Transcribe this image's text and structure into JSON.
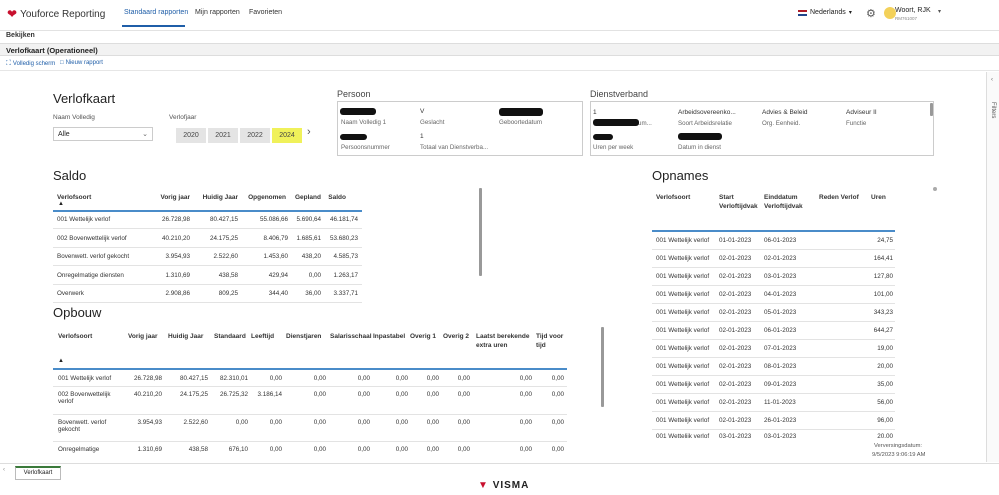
{
  "app": {
    "logo_text": "Youforce Reporting"
  },
  "nav": {
    "tabs": [
      "Standaard rapporten",
      "Mijn rapporten",
      "Favorieten"
    ],
    "active": "Standaard rapporten"
  },
  "header": {
    "language": "Nederlands",
    "user_name": "Woort, RJK",
    "user_id": "RM761007"
  },
  "subnav": {
    "label": "Bekijken"
  },
  "report": {
    "title": "Verlofkaart (Operationeel)"
  },
  "toolbar": {
    "fullscreen": "Volledig scherm",
    "new_report": "Nieuw rapport"
  },
  "filters": {
    "title": "Verlofkaart",
    "name_label": "Naam Volledig",
    "name_value": "Alle",
    "year_label": "Verlofjaar",
    "years": [
      "2020",
      "2021",
      "2022",
      "2024"
    ],
    "selected_year": "2024"
  },
  "persoon": {
    "title": "Persoon",
    "fields": [
      {
        "value": "",
        "label": "Naam Volledig 1"
      },
      {
        "value": "V",
        "label": "Geslacht"
      },
      {
        "value": "",
        "label": "Geboortedatum"
      },
      {
        "value": "",
        "label": "Persoonsnummer"
      },
      {
        "value": "1",
        "label": "Totaal van Dienstverba..."
      }
    ]
  },
  "dienstverband": {
    "title": "Dienstverband",
    "fields": [
      {
        "value": "1",
        "label": "Dienstverband num..."
      },
      {
        "value": "Arbeidsovereenko...",
        "label": "Soort Arbeidsrelatie"
      },
      {
        "value": "Advies & Beleid",
        "label": "Org. Eenheid."
      },
      {
        "value": "Adviseur II",
        "label": "Functie"
      },
      {
        "value": "",
        "label": "Uren per week"
      },
      {
        "value": "",
        "label": "Datum in dienst"
      }
    ]
  },
  "saldo": {
    "title": "Saldo",
    "columns": [
      "Verlofsoort",
      "Vorig jaar",
      "Huidig Jaar",
      "Opgenomen",
      "Gepland",
      "Saldo"
    ],
    "rows": [
      [
        "001 Wettelijk verlof",
        "26.728,98",
        "80.427,15",
        "55.086,66",
        "5.690,64",
        "46.181,74"
      ],
      [
        "002 Bovenwettelijk verlof",
        "40.210,20",
        "24.175,25",
        "8.406,79",
        "1.685,61",
        "53.680,23"
      ],
      [
        "Bovenwett. verlof gekocht",
        "3.954,93",
        "2.522,60",
        "1.453,60",
        "438,20",
        "4.585,73"
      ],
      [
        "Onregelmatige diensten",
        "1.310,69",
        "438,58",
        "429,94",
        "0,00",
        "1.263,17"
      ],
      [
        "Overwerk",
        "2.908,86",
        "809,25",
        "344,40",
        "36,00",
        "3.337,71"
      ]
    ]
  },
  "opbouw": {
    "title": "Opbouw",
    "columns": [
      "Verlofsoort",
      "Vorig jaar",
      "Huidig Jaar",
      "Standaard",
      "Leeftijd",
      "Dienstjaren",
      "Salarisschaal",
      "Inpastabel",
      "Overig 1",
      "Overig 2",
      "Laatst berekende extra uren",
      "Tijd voor tijd"
    ],
    "rows": [
      [
        "001 Wettelijk verlof",
        "26.728,98",
        "80.427,15",
        "82.310,01",
        "0,00",
        "0,00",
        "0,00",
        "0,00",
        "0,00",
        "0,00",
        "0,00",
        "0,00"
      ],
      [
        "002 Bovenwettelijk verlof",
        "40.210,20",
        "24.175,25",
        "26.725,32",
        "3.186,14",
        "0,00",
        "0,00",
        "0,00",
        "0,00",
        "0,00",
        "0,00",
        "0,00"
      ],
      [
        "Bovenwett. verlof gekocht",
        "3.954,93",
        "2.522,60",
        "0,00",
        "0,00",
        "0,00",
        "0,00",
        "0,00",
        "0,00",
        "0,00",
        "0,00",
        "0,00"
      ],
      [
        "Onregelmatige",
        "1.310,69",
        "438,58",
        "676,10",
        "0,00",
        "0,00",
        "0,00",
        "0,00",
        "0,00",
        "0,00",
        "0,00",
        "0,00"
      ]
    ]
  },
  "opnames": {
    "title": "Opnames",
    "columns": [
      "Verlofsoort",
      "Start Verloftijdvak",
      "Einddatum Verloftijdvak",
      "Reden Verlof",
      "Uren"
    ],
    "rows": [
      [
        "001 Wettelijk verlof",
        "01-01-2023",
        "06-01-2023",
        "",
        "24,75"
      ],
      [
        "001 Wettelijk verlof",
        "02-01-2023",
        "02-01-2023",
        "",
        "164,41"
      ],
      [
        "001 Wettelijk verlof",
        "02-01-2023",
        "03-01-2023",
        "",
        "127,80"
      ],
      [
        "001 Wettelijk verlof",
        "02-01-2023",
        "04-01-2023",
        "",
        "101,00"
      ],
      [
        "001 Wettelijk verlof",
        "02-01-2023",
        "05-01-2023",
        "",
        "343,23"
      ],
      [
        "001 Wettelijk verlof",
        "02-01-2023",
        "06-01-2023",
        "",
        "644,27"
      ],
      [
        "001 Wettelijk verlof",
        "02-01-2023",
        "07-01-2023",
        "",
        "19,00"
      ],
      [
        "001 Wettelijk verlof",
        "02-01-2023",
        "08-01-2023",
        "",
        "20,00"
      ],
      [
        "001 Wettelijk verlof",
        "02-01-2023",
        "09-01-2023",
        "",
        "35,00"
      ],
      [
        "001 Wettelijk verlof",
        "02-01-2023",
        "11-01-2023",
        "",
        "56,00"
      ],
      [
        "001 Wettelijk verlof",
        "02-01-2023",
        "26-01-2023",
        "",
        "96,00"
      ]
    ],
    "partial_row": [
      "001 Wettelijk verlof",
      "03-01-2023",
      "03-01-2023",
      "",
      "20,00"
    ]
  },
  "refresh": {
    "label": "Verversingsdatum:",
    "value": "9/5/2023 9:06:19 AM"
  },
  "right_panel": {
    "label": "Filters"
  },
  "sheet": {
    "tab": "Verlofkaart"
  },
  "footer": {
    "brand": "VISMA"
  },
  "colors": {
    "accent": "#1f5ea8",
    "brand_red": "#c8102e",
    "highlight": "#f0f15a"
  }
}
